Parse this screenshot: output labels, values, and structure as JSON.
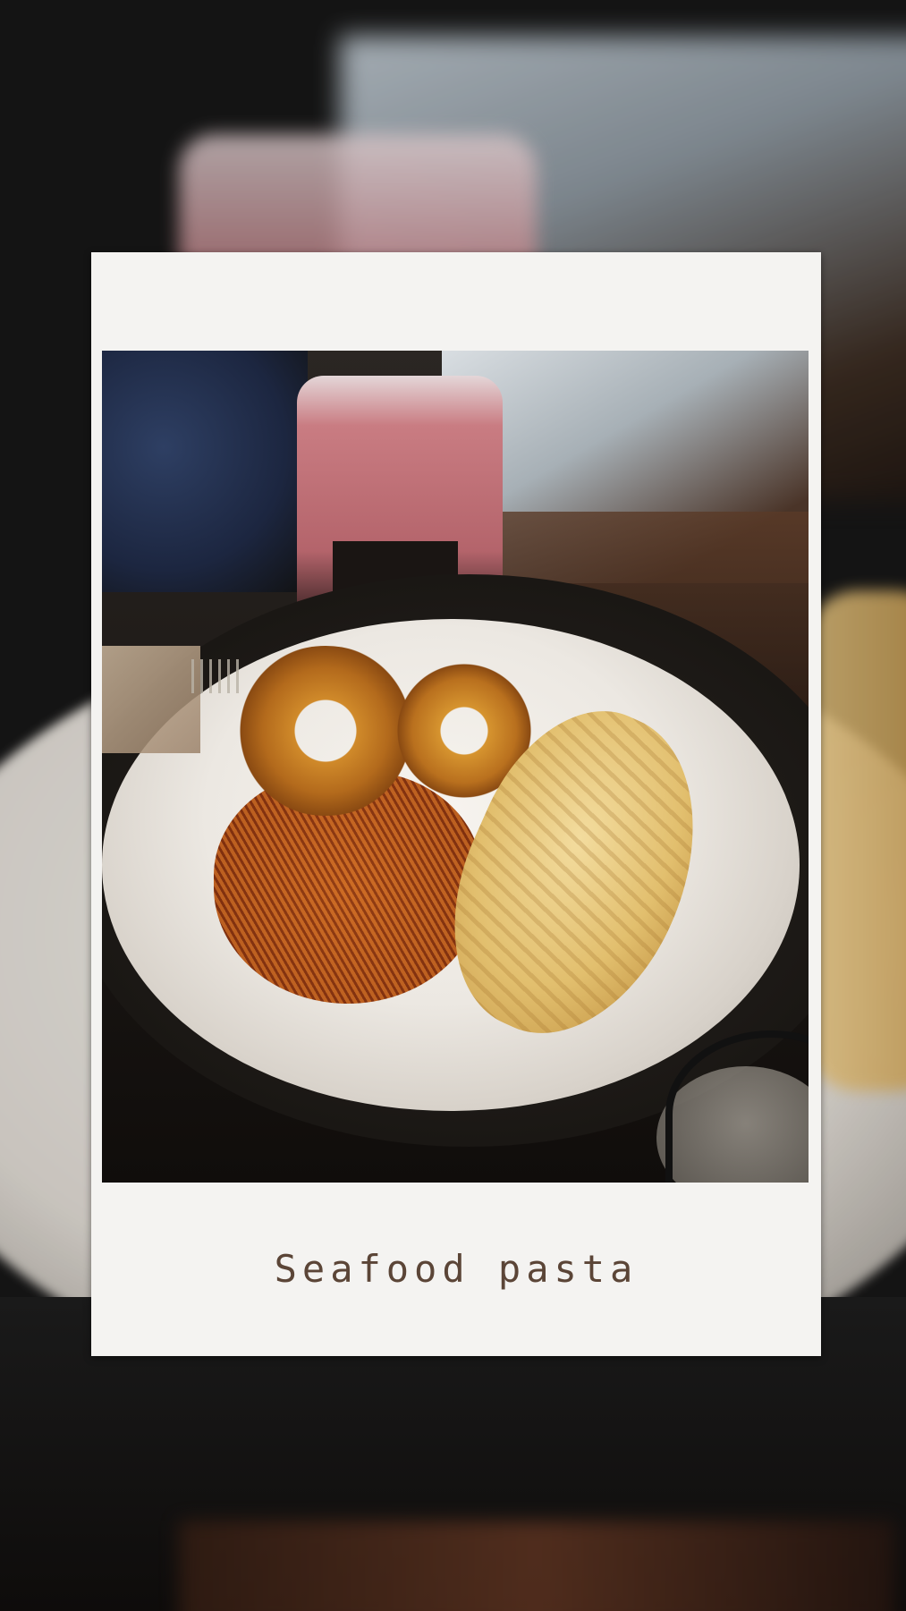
{
  "caption": "Seafood pasta"
}
